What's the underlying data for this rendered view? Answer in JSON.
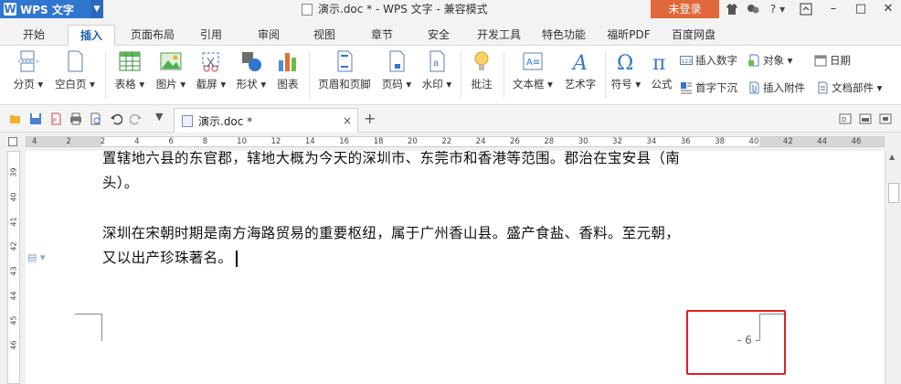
{
  "app": {
    "menu_label": "WPS 文字",
    "window_title": "演示.doc * - WPS 文字 - 兼容模式",
    "login_label": "未登录",
    "help_label": "?"
  },
  "menu_tabs": [
    {
      "label": "开始"
    },
    {
      "label": "插入",
      "active": true
    },
    {
      "label": "页面布局"
    },
    {
      "label": "引用"
    },
    {
      "label": "审阅"
    },
    {
      "label": "视图"
    },
    {
      "label": "章节"
    },
    {
      "label": "安全"
    },
    {
      "label": "开发工具"
    },
    {
      "label": "特色功能"
    },
    {
      "label": "福昕PDF"
    },
    {
      "label": "百度网盘"
    }
  ],
  "ribbon": {
    "buttons": [
      {
        "label": "分页 ▾",
        "icon": "page-break-icon"
      },
      {
        "label": "空白页 ▾",
        "icon": "blank-page-icon"
      },
      {
        "label": "表格 ▾",
        "icon": "table-icon"
      },
      {
        "label": "图片 ▾",
        "icon": "picture-icon"
      },
      {
        "label": "截屏 ▾",
        "icon": "screenshot-icon"
      },
      {
        "label": "形状 ▾",
        "icon": "shapes-icon"
      },
      {
        "label": "图表",
        "icon": "chart-icon"
      },
      {
        "label": "页眉和页脚",
        "icon": "header-footer-icon"
      },
      {
        "label": "页码 ▾",
        "icon": "page-number-icon"
      },
      {
        "label": "水印 ▾",
        "icon": "watermark-icon"
      },
      {
        "label": "批注",
        "icon": "comment-icon"
      },
      {
        "label": "文本框 ▾",
        "icon": "textbox-icon"
      },
      {
        "label": "艺术字",
        "icon": "wordart-icon"
      },
      {
        "label": "符号 ▾",
        "icon": "symbol-icon"
      },
      {
        "label": "公式",
        "icon": "formula-icon"
      }
    ],
    "small_buttons": [
      {
        "label": "插入数字",
        "icon": "insert-number-icon"
      },
      {
        "label": "对象 ▾",
        "icon": "object-icon"
      },
      {
        "label": "日期",
        "icon": "date-icon"
      },
      {
        "label": "首字下沉",
        "icon": "dropcap-icon"
      },
      {
        "label": "插入附件",
        "icon": "attachment-icon"
      },
      {
        "label": "文档部件 ▾",
        "icon": "doc-parts-icon"
      }
    ]
  },
  "doc_tab": {
    "label": "演示.doc *",
    "close": "×",
    "add": "+"
  },
  "ruler": {
    "h_marks": [
      "4",
      "2",
      "2",
      "4",
      "6",
      "8",
      "10",
      "12",
      "14",
      "16",
      "18",
      "20",
      "22",
      "24",
      "26",
      "28",
      "30",
      "32",
      "34",
      "36",
      "38",
      "40",
      "42",
      "44",
      "46"
    ],
    "v_marks": [
      "39",
      "40",
      "41",
      "42",
      "43",
      "44",
      "45",
      "46"
    ]
  },
  "document": {
    "lines": [
      "置辖地六县的东官郡，辖地大概为今天的深圳市、东莞市和香港等范围。郡治在宝安县（南",
      "头）。",
      "深圳在宋朝时期是南方海路贸易的重要枢纽，属于广州香山县。盛产食盐、香料。至元朝，",
      "又以出产珍珠著名。"
    ],
    "page_number": "- 6 -"
  }
}
